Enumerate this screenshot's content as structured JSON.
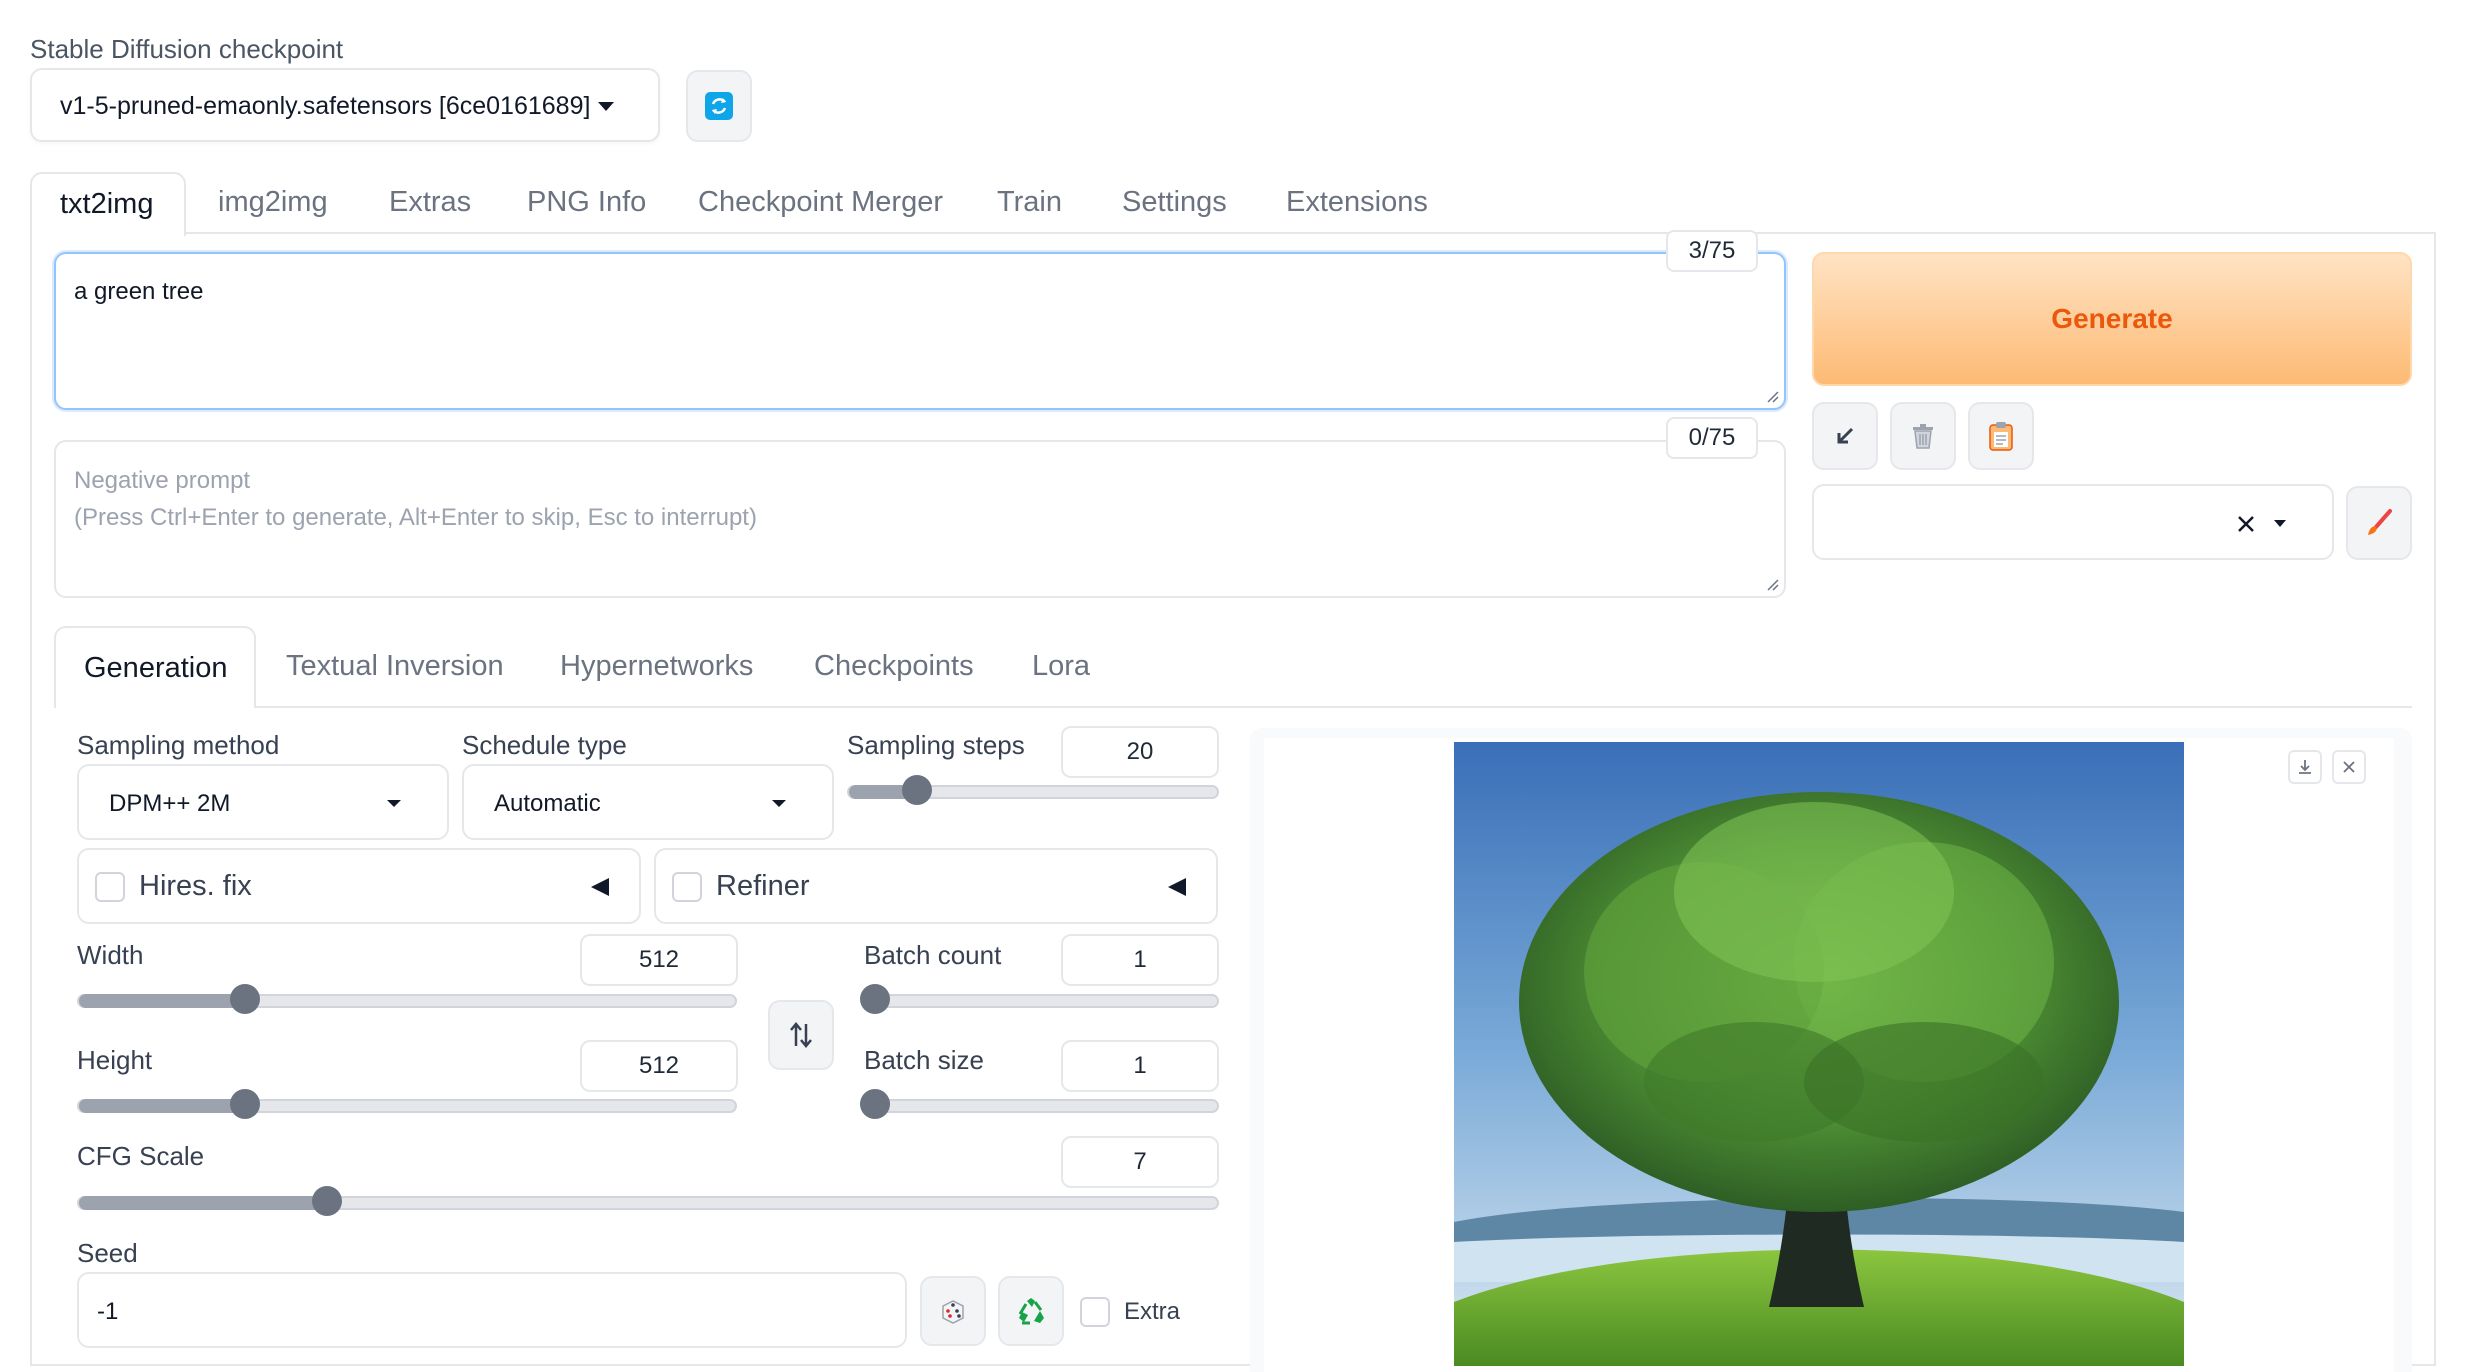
{
  "checkpoint": {
    "label": "Stable Diffusion checkpoint",
    "value": "v1-5-pruned-emaonly.safetensors [6ce0161689]"
  },
  "tabs": [
    "txt2img",
    "img2img",
    "Extras",
    "PNG Info",
    "Checkpoint Merger",
    "Train",
    "Settings",
    "Extensions"
  ],
  "prompt": {
    "value": "a green tree",
    "token_count": "3/75"
  },
  "negative_prompt": {
    "placeholder": "Negative prompt\n(Press Ctrl+Enter to generate, Alt+Enter to skip, Esc to interrupt)",
    "token_count": "0/75"
  },
  "generate_label": "Generate",
  "subtabs": [
    "Generation",
    "Textual Inversion",
    "Hypernetworks",
    "Checkpoints",
    "Lora"
  ],
  "sampling_method": {
    "label": "Sampling method",
    "value": "DPM++ 2M"
  },
  "schedule_type": {
    "label": "Schedule type",
    "value": "Automatic"
  },
  "sampling_steps": {
    "label": "Sampling steps",
    "value": "20",
    "fraction": 0.16
  },
  "hires_fix": {
    "label": "Hires. fix"
  },
  "refiner": {
    "label": "Refiner"
  },
  "width": {
    "label": "Width",
    "value": "512",
    "fraction": 0.24
  },
  "height": {
    "label": "Height",
    "value": "512",
    "fraction": 0.24
  },
  "batch_count": {
    "label": "Batch count",
    "value": "1",
    "fraction": 0.0
  },
  "batch_size": {
    "label": "Batch size",
    "value": "1",
    "fraction": 0.0
  },
  "cfg_scale": {
    "label": "CFG Scale",
    "value": "7",
    "fraction": 0.21
  },
  "seed": {
    "label": "Seed",
    "value": "-1"
  },
  "extra_label": "Extra",
  "colors": {
    "accent": "#0ea5e9",
    "generate_bg_top": "#fed7aa",
    "generate_bg_bottom": "#fdba74",
    "generate_text": "#ea580c"
  }
}
